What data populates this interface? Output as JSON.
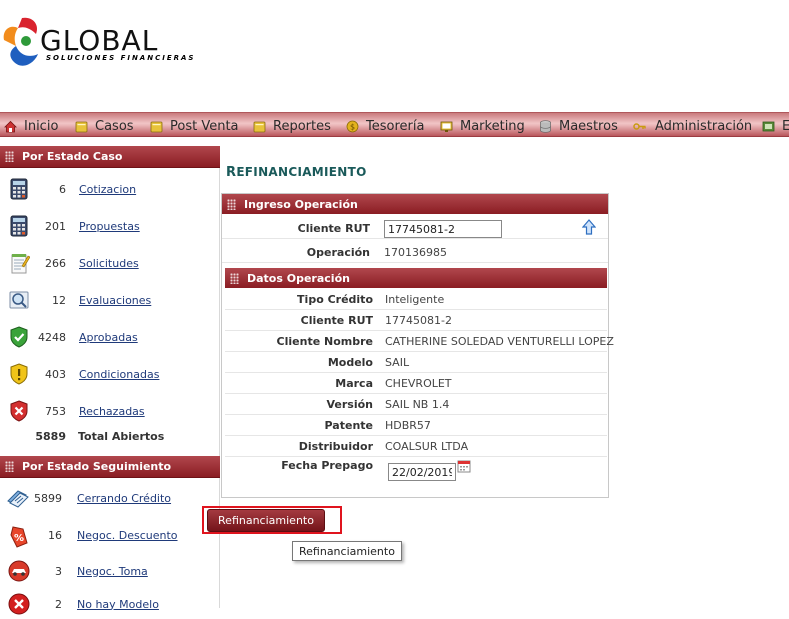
{
  "brand": {
    "name": "GLOBAL",
    "tagline": "SOLUCIONES FINANCIERAS",
    "colors": {
      "orange": "#f28c1c",
      "red": "#d9232e",
      "blue": "#1f5fbf",
      "green": "#2e9a3a"
    }
  },
  "menu": {
    "items": [
      {
        "label": "Inicio",
        "icon": "home-icon"
      },
      {
        "label": "Casos",
        "icon": "folder-icon"
      },
      {
        "label": "Post Venta",
        "icon": "folder-icon"
      },
      {
        "label": "Reportes",
        "icon": "folder-icon"
      },
      {
        "label": "Tesorería",
        "icon": "coin-icon"
      },
      {
        "label": "Marketing",
        "icon": "monitor-icon"
      },
      {
        "label": "Maestros",
        "icon": "database-icon"
      },
      {
        "label": "Administración",
        "icon": "key-icon"
      },
      {
        "label": "E",
        "icon": "gear-icon"
      }
    ]
  },
  "sidebar": {
    "estado_caso": {
      "title": "Por Estado Caso",
      "items": [
        {
          "count": "6",
          "label": "Cotizacion",
          "icon": "calculator-icon"
        },
        {
          "count": "201",
          "label": "Propuestas",
          "icon": "calculator-icon"
        },
        {
          "count": "266",
          "label": "Solicitudes",
          "icon": "notepad-icon"
        },
        {
          "count": "12",
          "label": "Evaluaciones",
          "icon": "magnifier-icon"
        },
        {
          "count": "4248",
          "label": "Aprobadas",
          "icon": "shield-check-icon"
        },
        {
          "count": "403",
          "label": "Condicionadas",
          "icon": "shield-warning-icon"
        },
        {
          "count": "753",
          "label": "Rechazadas",
          "icon": "shield-x-icon"
        }
      ],
      "total": {
        "count": "5889",
        "label": "Total Abiertos"
      }
    },
    "estado_seguimiento": {
      "title": "Por Estado Seguimiento",
      "items": [
        {
          "count": "5899",
          "label": "Cerrando Crédito",
          "icon": "documents-icon"
        },
        {
          "count": "16",
          "label": "Negoc. Descuento",
          "icon": "percent-tag-icon"
        },
        {
          "count": "3",
          "label": "Negoc. Toma",
          "icon": "car-icon"
        },
        {
          "count": "2",
          "label": "No hay Modelo",
          "icon": "red-x-icon"
        }
      ]
    }
  },
  "main": {
    "title_first": "R",
    "title_rest": "EFINANCIAMIENTO",
    "ingreso": {
      "title": "Ingreso Operación",
      "cliente_rut_label": "Cliente RUT",
      "cliente_rut_value": "17745081-2",
      "operacion_label": "Operación",
      "operacion_value": "170136985"
    },
    "datos": {
      "title": "Datos Operación",
      "rows": [
        {
          "label": "Tipo Crédito",
          "value": "Inteligente"
        },
        {
          "label": "Cliente RUT",
          "value": "17745081-2"
        },
        {
          "label": "Cliente Nombre",
          "value": "CATHERINE SOLEDAD VENTURELLI LOPEZ"
        },
        {
          "label": "Modelo",
          "value": "SAIL"
        },
        {
          "label": "Marca",
          "value": "CHEVROLET"
        },
        {
          "label": "Versión",
          "value": "SAIL NB 1.4"
        },
        {
          "label": "Patente",
          "value": "HDBR57"
        },
        {
          "label": "Distribuidor",
          "value": "COALSUR LTDA"
        }
      ],
      "fecha_prepago_label": "Fecha Prepago",
      "fecha_prepago_value": "22/02/2019"
    },
    "button_label": "Refinanciamiento",
    "tooltip": "Refinanciamiento"
  }
}
